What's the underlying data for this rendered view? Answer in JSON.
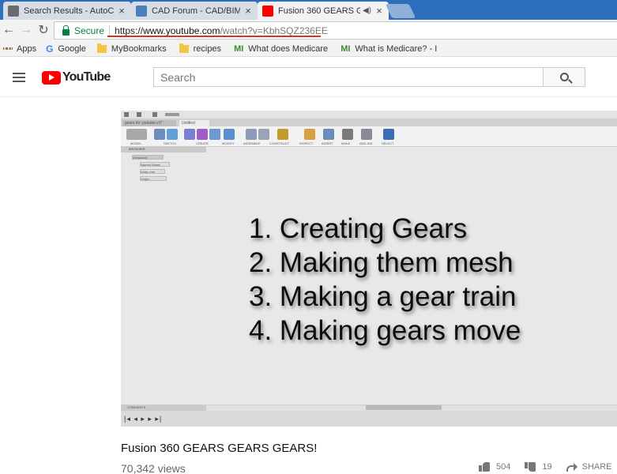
{
  "browser": {
    "tabs": [
      {
        "title": "Search Results - AutoCAD",
        "favicon": "autocad-icon",
        "active": false
      },
      {
        "title": "CAD Forum - CAD/BIM Li",
        "favicon": "cadforum-icon",
        "active": false
      },
      {
        "title": "Fusion 360 GEARS GE",
        "favicon": "youtube-icon",
        "active": true
      }
    ],
    "address": {
      "secure_label": "Secure",
      "url_scheme": "https://",
      "url_host": "www.youtube.com",
      "url_path": "/watch?v=KbhSQZ236EE"
    },
    "bookmarks": [
      {
        "label": "Apps",
        "icon": "apps-grid-icon"
      },
      {
        "label": "Google",
        "icon": "google-icon"
      },
      {
        "label": "MyBookmarks",
        "icon": "folder-icon"
      },
      {
        "label": "recipes",
        "icon": "folder-icon"
      },
      {
        "label": "What does Medicare",
        "icon": "mi-icon"
      },
      {
        "label": "What is Medicare? - I",
        "icon": "mi-icon"
      }
    ],
    "colors": {
      "tab_strip": "#2d6fbd",
      "secure_green": "#0b8043",
      "url_annotation_red": "#d93025"
    }
  },
  "youtube": {
    "logo_text": "YouTube",
    "search_placeholder": "Search",
    "brand_red": "#ff0000"
  },
  "video": {
    "fusion": {
      "doc_tabs": [
        "gears for youtube v1*",
        "Untitled"
      ],
      "ribbon": [
        "MODEL",
        "SKETCH",
        "CREATE",
        "MODIFY",
        "ASSEMBLE",
        "CONSTRUCT",
        "INSPECT",
        "INSERT",
        "MAKE",
        "ADD-INS",
        "SELECT"
      ],
      "browser_label": "BROWSER",
      "tree": [
        "(Unsaved)",
        "Named Views",
        "Units: mm",
        "Origin"
      ],
      "comments_label": "COMMENTS"
    },
    "steps": [
      "1. Creating Gears",
      "2. Making them mesh",
      "3. Making a gear train",
      "4. Making gears move"
    ],
    "title": "Fusion 360 GEARS GEARS GEARS!",
    "views": "70,342 views",
    "likes": "504",
    "dislikes": "19",
    "share_label": "SHARE"
  }
}
